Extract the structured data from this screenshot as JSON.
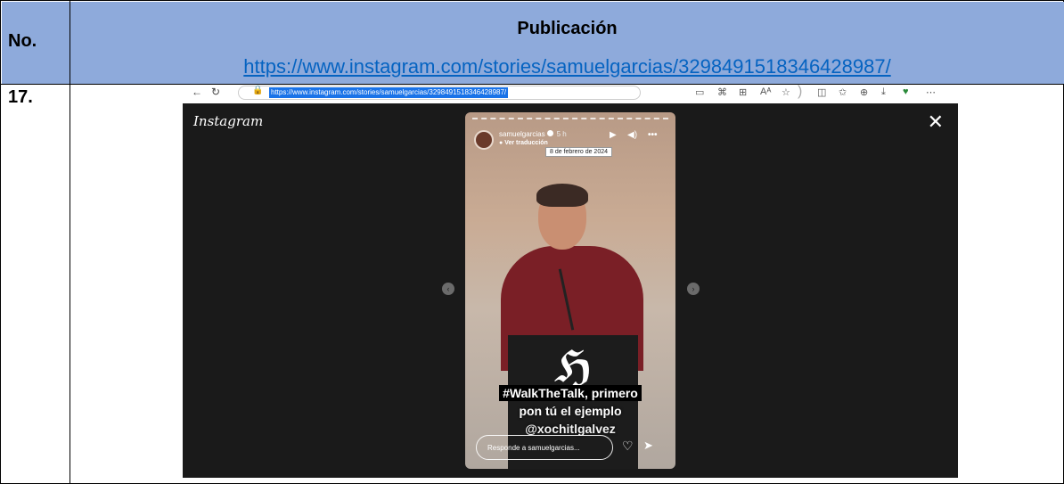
{
  "table": {
    "header_no": "No.",
    "header_publication": "Publicación",
    "publication_url": "https://www.instagram.com/stories/samuelgarcias/3298491518346428987/",
    "row_number": "17."
  },
  "browser": {
    "url": "https://www.instagram.com/stories/samuelgarcias/3298491518346428987/",
    "icons": [
      "back-icon",
      "refresh-icon",
      "lock-icon",
      "read-aloud-icon",
      "apps-icon",
      "grid-icon",
      "font-size-icon",
      "favorite-star-icon",
      "split-screen-icon",
      "favorites-icon",
      "collections-icon",
      "download-icon",
      "extension-icon",
      "more-icon"
    ]
  },
  "instagram": {
    "logo": "Instagram",
    "close_icon": "close-icon",
    "story": {
      "username": "samuelgarcias",
      "time": "5 h",
      "translate": "Ver traducción",
      "tooltip_date": "8 de febrero de 2024",
      "caption_line1": "#WalkTheTalk, primero",
      "caption_line2": "pon tú el ejemplo",
      "caption_line3": "@xochitlgalvez",
      "reply_placeholder": "Responde a samuelgarcias..."
    }
  },
  "colors": {
    "header_bg": "#8eaadb",
    "link": "#0563c1",
    "ig_bg": "#1a1a1a",
    "sweater": "#7a1f26"
  }
}
